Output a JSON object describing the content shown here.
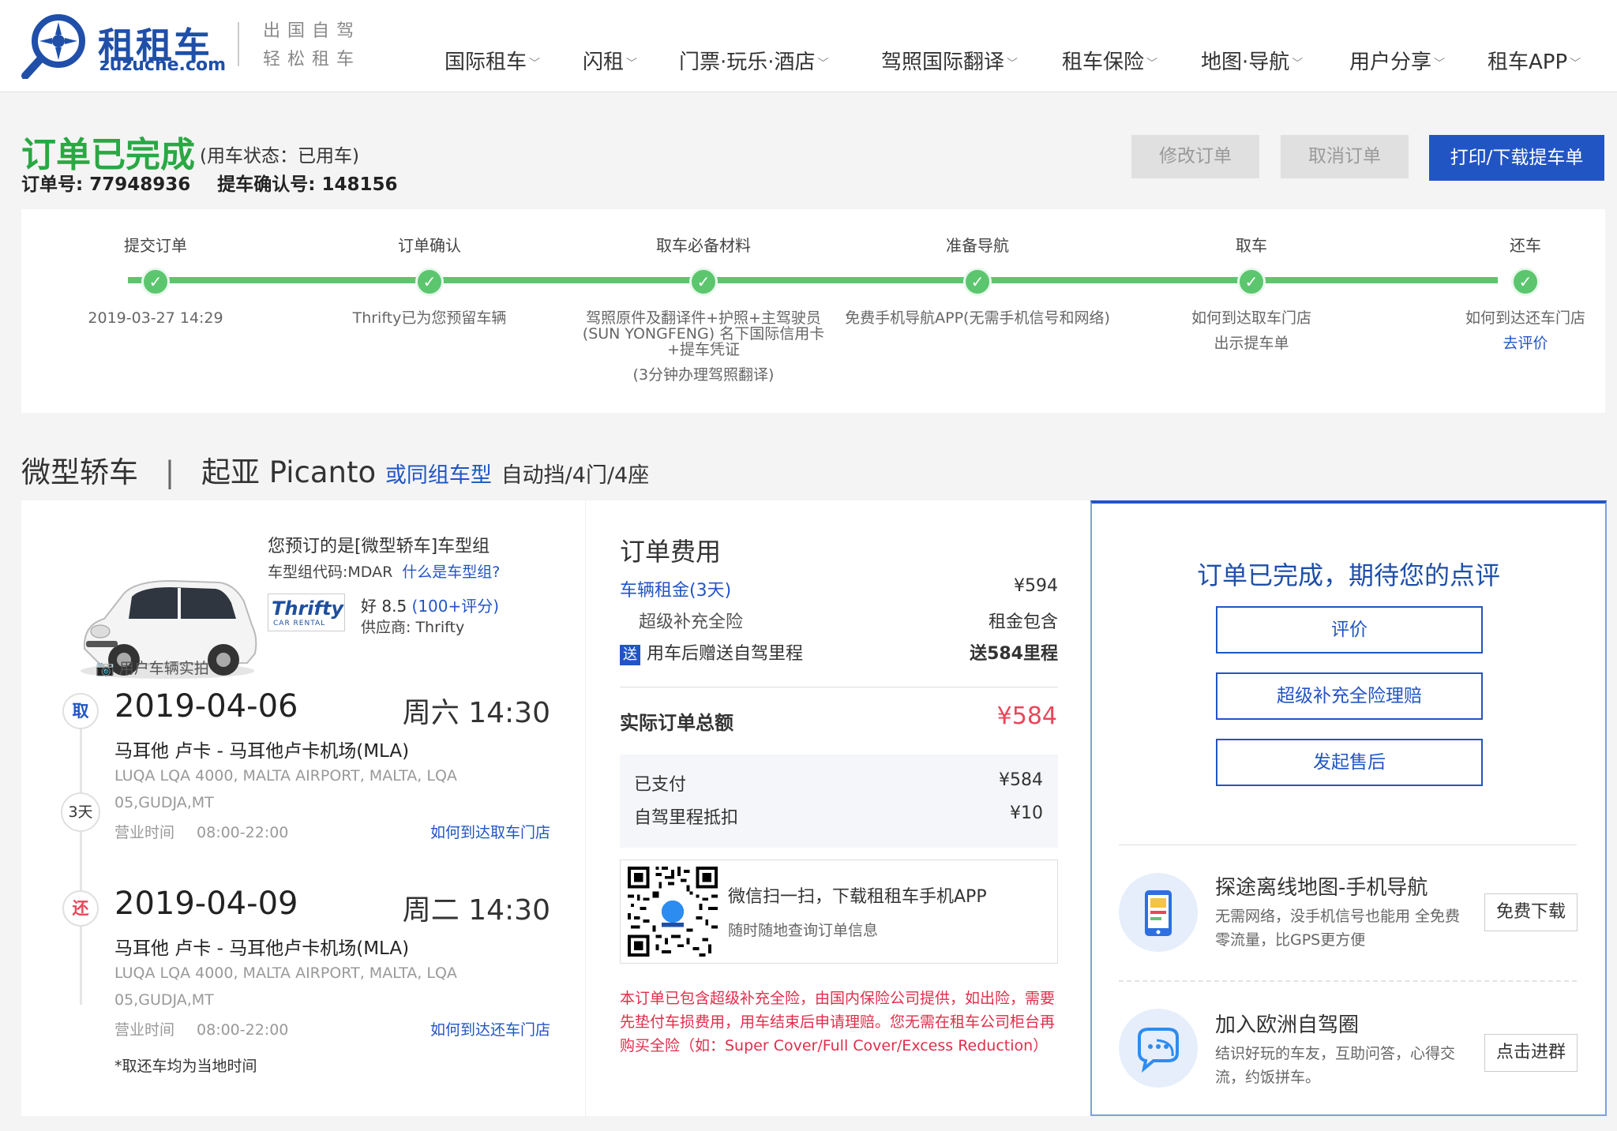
{
  "header": {
    "logo_cn": "租租车",
    "logo_en": "zuzuche.com",
    "slogan_line1": "出国自驾",
    "slogan_line2": "轻松租车",
    "nav": [
      {
        "label": "国际租车"
      },
      {
        "label": "闪租"
      },
      {
        "label": "门票·玩乐·酒店"
      },
      {
        "label": "驾照国际翻译"
      },
      {
        "label": "租车保险"
      },
      {
        "label": "地图·导航"
      },
      {
        "label": "用户分享"
      },
      {
        "label": "租车APP"
      }
    ]
  },
  "order": {
    "title": "订单已完成",
    "status": "(用车状态：已用车)",
    "order_no": "订单号: 77948936",
    "confirm_no": "提车确认号: 148156",
    "modify_label": "修改订单",
    "cancel_label": "取消订单",
    "print_label": "打印/下载提车单"
  },
  "progress": {
    "steps": [
      {
        "title": "提交订单",
        "desc": "2019-03-27 14:29"
      },
      {
        "title": "订单确认",
        "desc": "Thrifty已为您预留车辆"
      },
      {
        "title": "取车必备材料",
        "desc": "驾照原件及翻译件+护照+主驾驶员(SUN YONGFENG) 名下国际信用卡+提车凭证",
        "sub": "(3分钟办理驾照翻译)"
      },
      {
        "title": "准备导航",
        "desc": "免费手机导航APP(无需手机信号和网络)"
      },
      {
        "title": "取车",
        "desc": "如何到达取车门店",
        "sub": "出示提车单"
      },
      {
        "title": "还车",
        "desc": "如何到达还车门店",
        "link": "去评价"
      }
    ]
  },
  "car": {
    "category": "微型轿车",
    "separator": "|",
    "model": "起亚 Picanto",
    "similar": "或同组车型",
    "spec": "自动挡/4门/4座",
    "photo_caption": "用户车辆实拍",
    "pref_title": "您预订的是[微型轿车]车型组",
    "group_code": "车型组代码:MDAR",
    "group_link": "什么是车型组?",
    "supplier_logo": "Thrifty",
    "supplier_logo_sub": "CAR RENTAL",
    "rating_label": "好 8.5",
    "rating_count": "(100+评分)",
    "supplier": "供应商:  Thrifty"
  },
  "pickup": {
    "badge": "取",
    "date": "2019-04-06",
    "time": "周六 14:30",
    "location": "马耳他 卢卡 - 马耳他卢卡机场(MLA)",
    "address": "LUQA LQA 4000, MALTA AIRPORT, MALTA, LQA 05,GUDJA,MT",
    "hours_label": "营业时间",
    "hours": "08:00-22:00",
    "link": "如何到达取车门店"
  },
  "duration": "3天",
  "dropoff": {
    "badge": "还",
    "date": "2019-04-09",
    "time": "周二 14:30",
    "location": "马耳他 卢卡 - 马耳他卢卡机场(MLA)",
    "address": "LUQA LQA 4000, MALTA AIRPORT, MALTA, LQA 05,GUDJA,MT",
    "hours_label": "营业时间",
    "hours": "08:00-22:00",
    "link": "如何到达还车门店"
  },
  "footnote": "*取还车均为当地时间",
  "fees": {
    "title": "订单费用",
    "rent_label": "车辆租金(3天)",
    "rent_value": "¥594",
    "insurance_label": "超级补充全险",
    "insurance_value": "租金包含",
    "gift_badge": "送",
    "gift_label": "用车后赠送自驾里程",
    "gift_value": "送584里程",
    "total_label": "实际订单总额",
    "total_value": "¥584",
    "paid_label": "已支付",
    "paid_value": "¥584",
    "mileage_label": "自驾里程抵扣",
    "mileage_value": "¥10",
    "qr_title": "微信扫一扫，下载租租车手机APP",
    "qr_sub": "随时随地查询订单信息",
    "warning": "本订单已包含超级补充全险，由国内保险公司提供，如出险，需要先垫付车损费用，用车结束后申请理赔。您无需在租车公司柜台再购买全险（如：Super Cover/Full Cover/Excess Reduction）"
  },
  "review": {
    "title": "订单已完成，期待您的点评",
    "btn_review": "评价",
    "btn_claim": "超级补充全险理赔",
    "btn_aftersale": "发起售后"
  },
  "promos": [
    {
      "title": "探途离线地图-手机导航",
      "desc": "无需网络，没手机信号也能用 全免费零流量，比GPS更方便",
      "btn": "免费下载",
      "icon": "phone-map-icon"
    },
    {
      "title": "加入欧洲自驾圈",
      "desc": "结识好玩的车友，互助问答，心得交流，约饭拼车。",
      "btn": "点击进群",
      "icon": "chat-bubble-icon"
    }
  ],
  "colors": {
    "brand_blue": "#2255c4",
    "success_green": "#2aa843",
    "progress_green": "#5cc66f",
    "price_red": "#e9465a",
    "warning_red": "#e12d4b"
  }
}
